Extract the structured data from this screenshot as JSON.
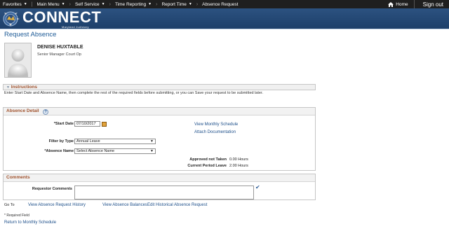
{
  "topnav": {
    "items": [
      {
        "label": "Favorites"
      },
      {
        "label": "Main Menu"
      },
      {
        "label": "Self Service"
      },
      {
        "label": "Time Reporting"
      },
      {
        "label": "Report Time"
      }
    ],
    "current": "Absence Request",
    "home_label": "Home",
    "signout_label": "Sign out"
  },
  "banner": {
    "logo_text": "CONNECT",
    "logo_sub": "Maryland Judiciary"
  },
  "page": {
    "title": "Request Absence"
  },
  "employee": {
    "name": "DENISE HUXTABLE",
    "title": "Senior Manager Court Op"
  },
  "instructions": {
    "heading": "Instructions",
    "text": "Enter Start Date and Absence Name, then complete the rest of the required fields before submitting, or you can Save your request to be submitted later."
  },
  "absence_detail": {
    "heading": "Absence Detail",
    "start_date_label": "*Start Date",
    "start_date_value": "07/10/2017",
    "filter_label": "Filter by Type",
    "filter_value": "Annual Leave",
    "absence_name_label": "*Absence Name",
    "absence_name_value": "Select Absence Name",
    "view_monthly_link": "View Monthly Schedule",
    "attach_doc_link": "Attach Documentation",
    "approved_label": "Approved not Taken",
    "approved_value": "0.00 Hours",
    "current_period_label": "Current Period Leave",
    "current_period_value": "2.00 Hours"
  },
  "comments": {
    "heading": "Comments",
    "requestor_label": "Requestor Comments",
    "requestor_value": ""
  },
  "goto": {
    "label": "Go To",
    "links": [
      "View Absence Request History",
      "View Absence Balances",
      "Edit Historical Absence Request"
    ]
  },
  "footer": {
    "required_note": "* Required Field",
    "return_link": "Return to Monthly Schedule"
  },
  "colors": {
    "nav_bg": "#1f1f1f",
    "banner_bg": "#1d3f6a",
    "link": "#1d4f8a",
    "section_heading": "#a0522d",
    "title": "#1d5a96"
  }
}
